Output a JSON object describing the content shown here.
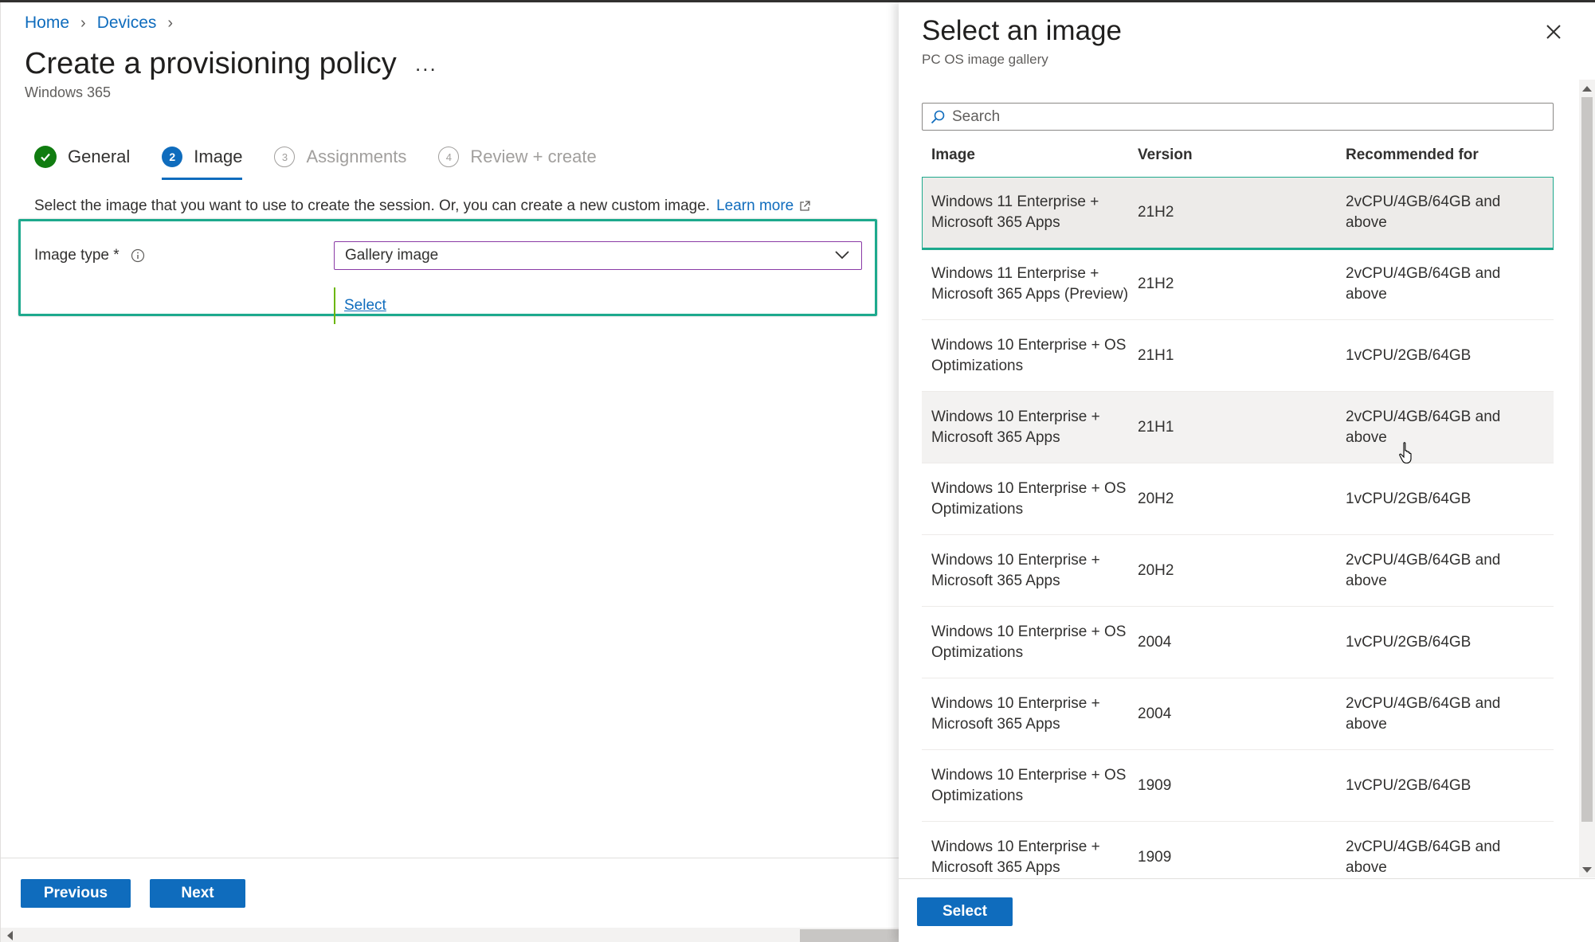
{
  "breadcrumb": {
    "home": "Home",
    "devices": "Devices"
  },
  "page": {
    "title": "Create a provisioning policy",
    "more": "...",
    "subtitle": "Windows 365"
  },
  "steps": [
    {
      "num": "",
      "label": "General",
      "state": "done"
    },
    {
      "num": "2",
      "label": "Image",
      "state": "active"
    },
    {
      "num": "3",
      "label": "Assignments",
      "state": "todo"
    },
    {
      "num": "4",
      "label": "Review + create",
      "state": "todo"
    }
  ],
  "image_section": {
    "instruction": "Select the image that you want to use to create the session. Or, you can create a new custom image.",
    "learn_more": "Learn more",
    "image_type_label": "Image type *",
    "image_type_value": "Gallery image",
    "select_link": "Select"
  },
  "footer": {
    "previous": "Previous",
    "next": "Next"
  },
  "panel": {
    "title": "Select an image",
    "subtitle": "PC OS image gallery",
    "search_placeholder": "Search",
    "columns": {
      "image": "Image",
      "version": "Version",
      "recommended": "Recommended for"
    },
    "rows": [
      {
        "image": "Windows 11 Enterprise + Microsoft 365 Apps",
        "version": "21H2",
        "recommended": "2vCPU/4GB/64GB and above",
        "state": "selected"
      },
      {
        "image": "Windows 11 Enterprise + Microsoft 365 Apps (Preview)",
        "version": "21H2",
        "recommended": "2vCPU/4GB/64GB and above",
        "state": ""
      },
      {
        "image": "Windows 10 Enterprise + OS Optimizations",
        "version": "21H1",
        "recommended": "1vCPU/2GB/64GB",
        "state": ""
      },
      {
        "image": "Windows 10 Enterprise + Microsoft 365 Apps",
        "version": "21H1",
        "recommended": "2vCPU/4GB/64GB and above",
        "state": "hover"
      },
      {
        "image": "Windows 10 Enterprise + OS Optimizations",
        "version": "20H2",
        "recommended": "1vCPU/2GB/64GB",
        "state": ""
      },
      {
        "image": "Windows 10 Enterprise + Microsoft 365 Apps",
        "version": "20H2",
        "recommended": "2vCPU/4GB/64GB and above",
        "state": ""
      },
      {
        "image": "Windows 10 Enterprise + OS Optimizations",
        "version": "2004",
        "recommended": "1vCPU/2GB/64GB",
        "state": ""
      },
      {
        "image": "Windows 10 Enterprise + Microsoft 365 Apps",
        "version": "2004",
        "recommended": "2vCPU/4GB/64GB and above",
        "state": ""
      },
      {
        "image": "Windows 10 Enterprise + OS Optimizations",
        "version": "1909",
        "recommended": "1vCPU/2GB/64GB",
        "state": ""
      },
      {
        "image": "Windows 10 Enterprise + Microsoft 365 Apps",
        "version": "1909",
        "recommended": "2vCPU/4GB/64GB and above",
        "state": ""
      }
    ],
    "select_button": "Select"
  },
  "colors": {
    "accent": "#0f6cbd",
    "highlight_box": "#1da98d",
    "done": "#107c10"
  }
}
